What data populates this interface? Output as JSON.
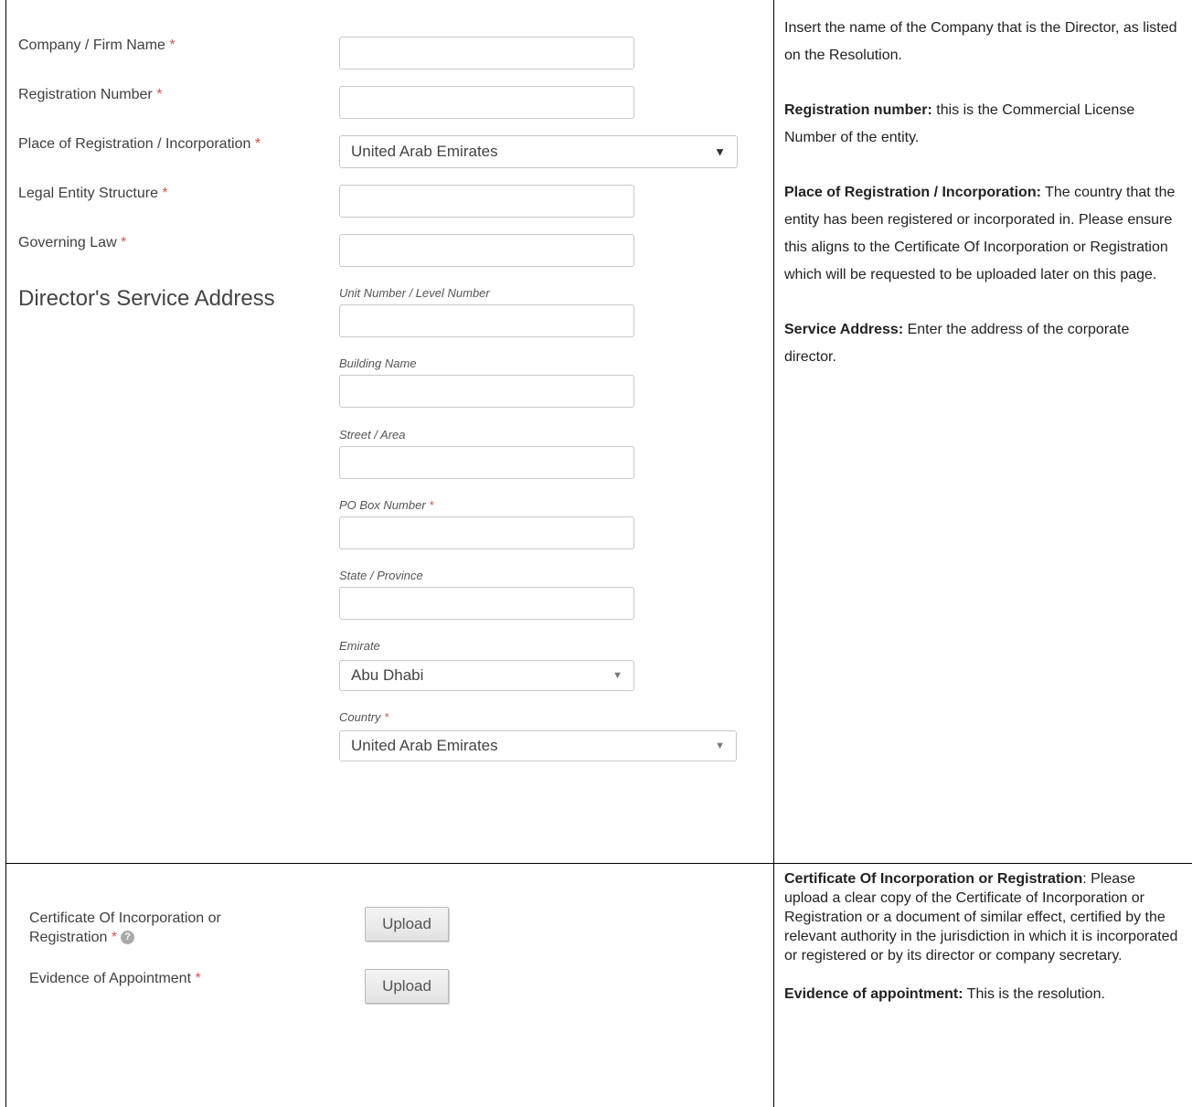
{
  "form": {
    "company_name": {
      "label": "Company / Firm Name",
      "req": "*",
      "value": ""
    },
    "registration_number": {
      "label": "Registration Number",
      "req": "*",
      "value": ""
    },
    "place_of_registration": {
      "label": "Place of Registration / Incorporation",
      "req": "*",
      "selected": "United Arab Emirates"
    },
    "legal_entity_structure": {
      "label": "Legal Entity Structure",
      "req": "*",
      "value": ""
    },
    "governing_law": {
      "label": "Governing Law",
      "req": "*",
      "value": ""
    }
  },
  "address": {
    "title": "Director's Service Address",
    "unit": {
      "label": "Unit Number / Level Number",
      "value": ""
    },
    "building": {
      "label": "Building Name",
      "value": ""
    },
    "street": {
      "label": "Street / Area",
      "value": ""
    },
    "po_box": {
      "label": "PO Box Number",
      "req": "*",
      "value": ""
    },
    "state": {
      "label": "State / Province",
      "value": ""
    },
    "emirate": {
      "label": "Emirate",
      "selected": "Abu Dhabi"
    },
    "country": {
      "label": "Country",
      "req": "*",
      "selected": "United Arab Emirates"
    }
  },
  "help_top": {
    "p1": "Insert the name of the Company that is the Director, as listed on the Resolution.",
    "p2_bold": "Registration number:",
    "p2_text": " this is the Commercial License Number of the entity.",
    "p3_bold": "Place of Registration / Incorporation:",
    "p3_text": " The country that the entity has been registered or incorporated in. Please ensure this aligns to the Certificate Of Incorporation or Registration which will be requested to be uploaded later on this page.",
    "p4_bold": "Service Address:",
    "p4_text": " Enter the address of the corporate director."
  },
  "uploads": {
    "certificate": {
      "label_line1": "Certificate Of Incorporation or",
      "label_line2": "Registration",
      "req": "*",
      "button": "Upload",
      "help_icon": "question-circle-icon"
    },
    "evidence": {
      "label": "Evidence of Appointment",
      "req": "*",
      "button": "Upload"
    }
  },
  "help_bottom": {
    "p1_bold": "Certificate Of Incorporation or Registration",
    "p1_text": ": Please upload a clear copy of the Certificate of Incorporation or Registration or a document of similar effect, certified by the relevant authority in the jurisdiction in which it is incorporated or registered or by its director or company secretary.",
    "p2_bold": "Evidence of appointment:",
    "p2_text": " This is the resolution."
  },
  "colors": {
    "required": "#d9534f",
    "border": "#c8c8c8",
    "frame": "#000000"
  }
}
